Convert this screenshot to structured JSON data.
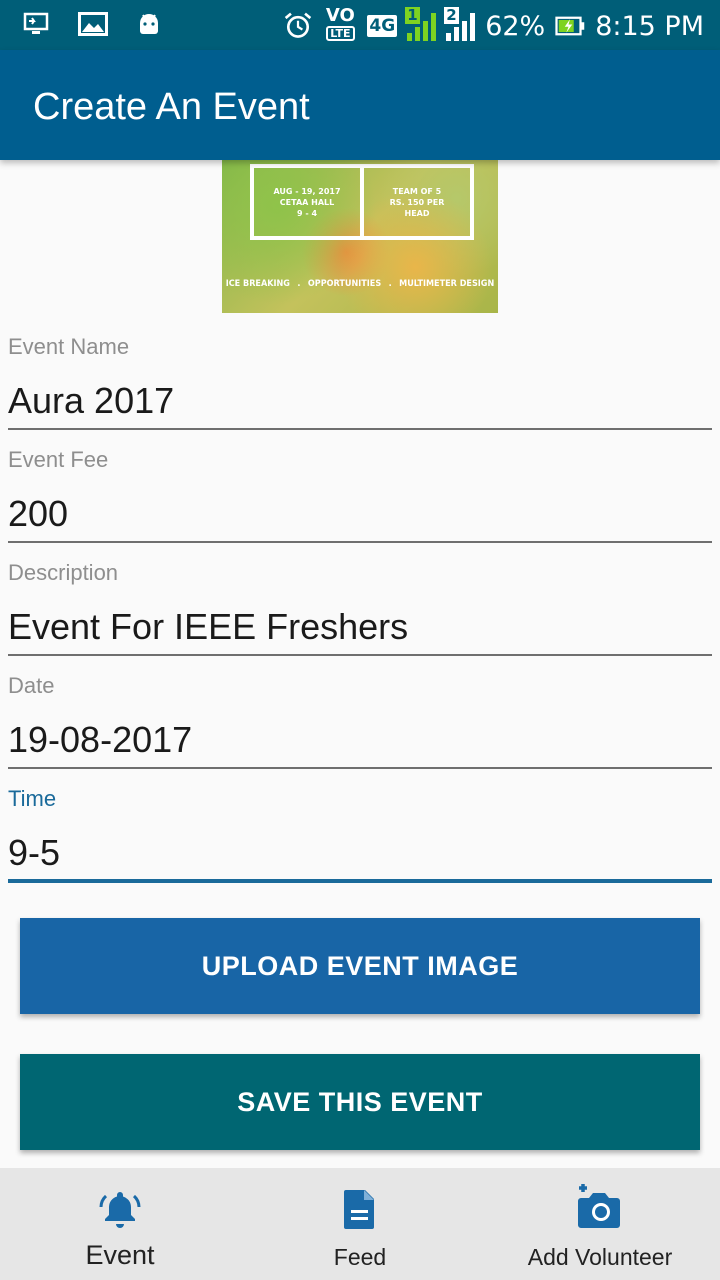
{
  "status_bar": {
    "battery_percent": "62%",
    "time": "8:15 PM",
    "volte": "VO",
    "lte": "LTE",
    "network": "4G",
    "sim1": "1",
    "sim2": "2",
    "icons": [
      "screen-cast-icon",
      "image-icon",
      "android-icon",
      "alarm-icon",
      "signal-icon",
      "battery-charging-icon"
    ]
  },
  "app_bar": {
    "title": "Create An Event"
  },
  "banner": {
    "date_line1": "AUG - 19, 2017",
    "date_line2": "CETAA HALL",
    "date_line3": "9 - 4",
    "team_line1": "TEAM OF 5",
    "team_line2": "RS. 150 PER",
    "team_line3": "HEAD",
    "tag1": "ICE BREAKING",
    "tag2": "OPPORTUNITIES",
    "tag3": "MULTIMETER DESIGN",
    "sep": "."
  },
  "form": {
    "event_name": {
      "label": "Event Name",
      "value": "Aura 2017"
    },
    "event_fee": {
      "label": "Event Fee",
      "value": "200"
    },
    "description": {
      "label": "Description",
      "value": "Event For IEEE Freshers"
    },
    "date": {
      "label": "Date",
      "value": "19-08-2017"
    },
    "time": {
      "label": "Time",
      "value": "9-5"
    }
  },
  "buttons": {
    "upload": "UPLOAD EVENT IMAGE",
    "save": "SAVE THIS EVENT"
  },
  "bottom_nav": {
    "items": [
      {
        "label": "Event",
        "icon": "bell-icon"
      },
      {
        "label": "Feed",
        "icon": "document-icon"
      },
      {
        "label": "Add Volunteer",
        "icon": "add-photo-icon"
      }
    ]
  },
  "colors": {
    "status_bar": "#005e78",
    "app_bar": "#005e8f",
    "accent": "#1a6a9a",
    "upload_button": "#1865a6",
    "save_button": "#006672",
    "nav_icon": "#1a6aa8"
  }
}
